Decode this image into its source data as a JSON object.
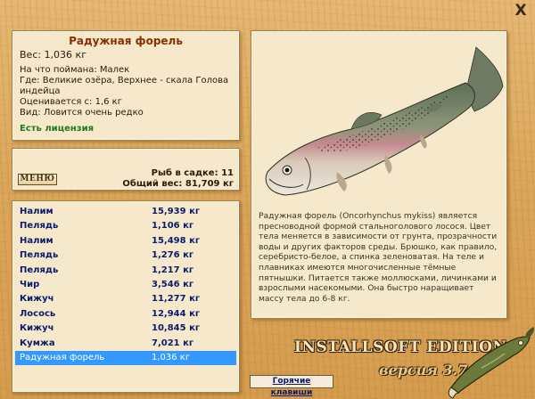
{
  "window": {
    "close_label": "X"
  },
  "fish_info": {
    "title": "Радужная форель",
    "weight": "Вес: 1,036 кг",
    "bait": "На что поймана: Малек",
    "location": "Где: Великие озёра, Верхнее - скала Голова индейца",
    "valued": "Оценивается с: 1,6 кг",
    "rarity": "Вид: Ловится очень редко",
    "license": "Есть лицензия"
  },
  "cage": {
    "menu_label": "МЕНЮ",
    "fish_count": "Рыб в садке: 11",
    "total_weight": "Общий вес: 81,709 кг"
  },
  "catch_list": [
    {
      "name": "Налим",
      "weight": "15,939 кг"
    },
    {
      "name": "Пелядь",
      "weight": "1,106 кг"
    },
    {
      "name": "Налим",
      "weight": "15,498 кг"
    },
    {
      "name": "Пелядь",
      "weight": "1,276 кг"
    },
    {
      "name": "Пелядь",
      "weight": "1,217 кг"
    },
    {
      "name": "Чир",
      "weight": "3,546 кг"
    },
    {
      "name": "Кижуч",
      "weight": "11,277 кг"
    },
    {
      "name": "Лосось",
      "weight": "12,944 кг"
    },
    {
      "name": "Кижуч",
      "weight": "10,845 кг"
    },
    {
      "name": "Кумжа",
      "weight": "7,021 кг"
    },
    {
      "name": "Радужная форель",
      "weight": "1,036 кг",
      "selected": true
    }
  ],
  "description": "Радужная форель (Oncorhynchus mykiss) является пресноводной формой стальноголового лосося. Цвет тела меняется в зависимости от грунта, прозрачности воды и других факторов среды. Брюшко, как правило, серебристо-белое, а спинка зеленоватая. На теле и плавниках имеются многочисленные тёмные пятнышки. Питается также моллюсками, личинками и взрослыми насекомыми. Она быстро наращивает массу тела до 6-8 кг.",
  "branding": {
    "edition": "INSTALLSOFT EDITION",
    "version": "версия 3.7.6"
  },
  "hotkeys_label": "Горячие клавиши",
  "colors": {
    "selection": "#3399ff",
    "list_text": "#0b1a6e",
    "title": "#8a2f00",
    "license": "#1f7a1f"
  },
  "icons": {
    "fish_image": "rainbow-trout",
    "logo": "pike-fish-icon",
    "close": "close-icon"
  }
}
